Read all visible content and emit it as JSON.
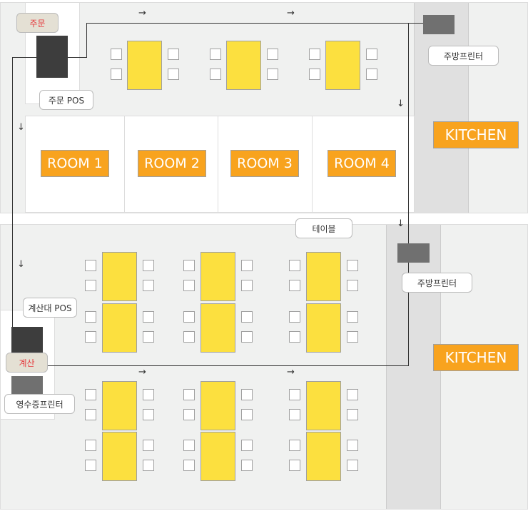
{
  "labels": {
    "order": "주문",
    "order_pos": "주문 POS",
    "kitchen_printer_top": "주방프린터",
    "kitchen_printer_bottom": "주방프린터",
    "table": "테이블",
    "checkout_pos": "계산대 POS",
    "checkout": "계산",
    "receipt_printer": "영수증프린터",
    "kitchen_top": "KITCHEN",
    "kitchen_bottom": "KITCHEN"
  },
  "rooms": [
    "ROOM 1",
    "ROOM 2",
    "ROOM 3",
    "ROOM 4"
  ],
  "arrows": {
    "right": "→",
    "down": "↓"
  },
  "colors": {
    "table": "#fce03f",
    "label": "#f8a31e",
    "device": "#3d3d3d",
    "printer": "#707070",
    "highlight_text": "#e5383b"
  }
}
